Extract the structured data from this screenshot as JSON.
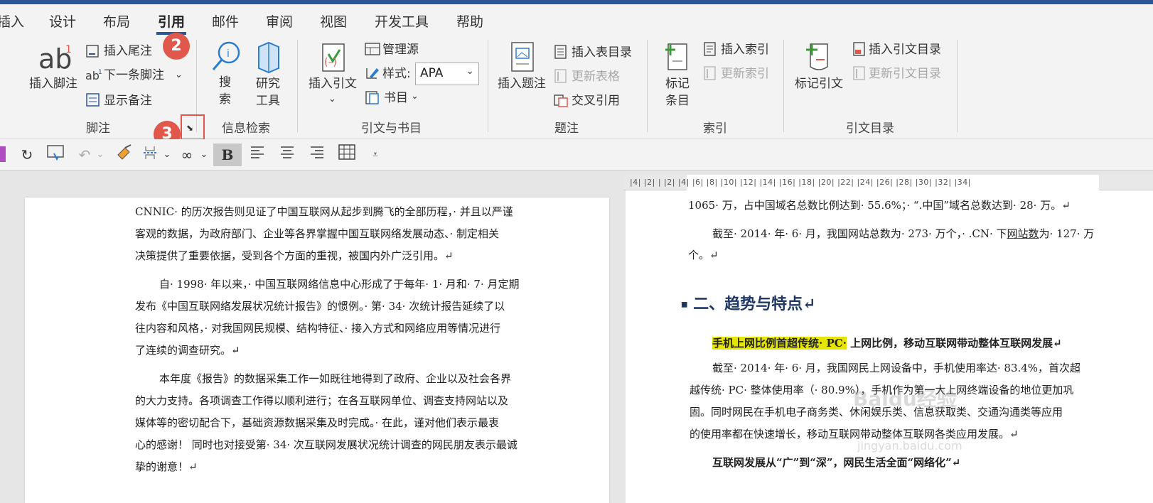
{
  "ribbon_tabs": [
    "插入",
    "设计",
    "布局",
    "引用",
    "邮件",
    "审阅",
    "视图",
    "开发工具",
    "帮助"
  ],
  "active_tab": "引用",
  "footnotes_group": {
    "insert_footnote": "插入脚注",
    "insert_endnote": "插入尾注",
    "next_footnote": "下一条脚注",
    "show_notes": "显示备注",
    "label": "脚注"
  },
  "research_group": {
    "search": "搜\n索",
    "search_l1": "搜",
    "search_l2": "索",
    "researcher_l1": "研究",
    "researcher_l2": "工具",
    "label": "信息检索"
  },
  "citations_group": {
    "insert_citation": "插入引文",
    "manage_sources": "管理源",
    "style_label": "样式:",
    "style_value": "APA",
    "bibliography": "书目",
    "label": "引文与书目"
  },
  "captions_group": {
    "insert_caption": "插入题注",
    "insert_table_of_figures": "插入表目录",
    "update_table": "更新表格",
    "cross_reference": "交叉引用",
    "label": "题注"
  },
  "index_group": {
    "mark_entry_l1": "标记",
    "mark_entry_l2": "条目",
    "insert_index": "插入索引",
    "update_index": "更新索引",
    "label": "索引"
  },
  "toa_group": {
    "mark_citation": "标记引文",
    "insert_toa": "插入引文目录",
    "update_toa": "更新引文目录",
    "label": "引文目录"
  },
  "callouts": [
    "2",
    "3"
  ],
  "ruler_ticks": "|4|  |2|        |  |2|  |4|  |6|  |8|  |10|  |12|  |14|  |16|  |18|  |20|  |22|  |24|  |26|  |28|  |30|  |32|  |34|",
  "left_doc": {
    "p1": [
      "CNNIC· 的历次报告则见证了中国互联网从起步到腾飞的全部历程，· 并且以严谨",
      "客观的数据，为政府部门、企业等各界掌握中国互联网络发展动态、· 制定相关",
      "决策提供了重要依据，受到各个方面的重视，被国内外广泛引用。↵"
    ],
    "p2": [
      "自· 1998· 年以来，· 中国互联网络信息中心形成了于每年· 1· 月和· 7· 月定期",
      "发布《中国互联网络发展状况统计报告》的惯例。· 第· 34· 次统计报告延续了以",
      "往内容和风格，· 对我国网民规模、结构特征、· 接入方式和网络应用等情况进行",
      "了连续的调查研究。↵"
    ],
    "p3": [
      "本年度《报告》的数据采集工作一如既往地得到了政府、企业以及社会各界",
      "的大力支持。各项调查工作得以顺利进行；在各互联网单位、调查支持网站以及",
      "媒体等的密切配合下，基础资源数据采集及时完成。· 在此，谨对他们表示最衷",
      "心的感谢！ 同时也对接受第· 34· 次互联网发展状况统计调查的网民朋友表示最诚",
      "挚的谢意！↵"
    ]
  },
  "right_doc": {
    "line1": "1065· 万，占中国域名总数比例达到· 55.6%；· “.中国”域名总数达到· 28· 万。↵",
    "line2a": "截至· 2014· 年· 6· 月，我国网站总数为· 273· 万个，· .CN· 下",
    "line2_link": "网站数",
    "line2b": "为· 127· 万",
    "line3": "个。↵",
    "heading": "二、趋势与特点↵",
    "bold_highlighted": "手机上网比例首超传统· PC·",
    "bold_rest": " 上网比例，移动互联网带动整体互联网发展↵",
    "body": [
      "截至· 2014· 年· 6· 月，我国网民上网设备中，手机使用率达· 83.4%，首次超",
      "越传统· PC· 整体使用率（· 80.9%），手机作为第一大上网终端设备的地位更加巩",
      "固。同时网民在手机电子商务类、休闲娱乐类、信息获取类、交通沟通类等应用",
      "的使用率都在快速增长，移动互联网带动整体互联网各类应用发展。↵"
    ],
    "bold2": "互联网发展从“广”到“深”，网民生活全面“网络化”↵"
  },
  "watermark": "Baidu经验",
  "watermark_url": "jingyan.baidu.com",
  "colors": {
    "accent": "#2b579a",
    "callout": "#e2574c",
    "highlight": "#e5e500"
  }
}
